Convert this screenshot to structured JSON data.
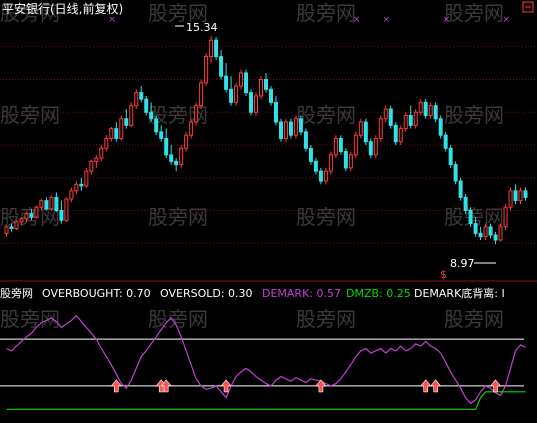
{
  "title": "平安银行(日线,前复权)",
  "watermark": "股旁网",
  "colors": {
    "background": "#000000",
    "up_candle": "#ff3b3b",
    "down_candle": "#33e0e8",
    "gridline": "#6e0f0f",
    "demark_line": "#c040d0",
    "dmzb_line": "#00dd00",
    "indicator_white": "#ffffff",
    "arrow": "#ff5050",
    "title": "#ffffff",
    "marker_x": "#c040d0"
  },
  "price_panel": {
    "high_label": "15.34",
    "low_label": "8.97"
  },
  "indicator_panel": {
    "name": "股旁网",
    "overbought_label": "OVERBOUGHT: 0.70",
    "oversold_label": "OVERSOLD: 0.30",
    "demark_label": "DEMARK: 0.57",
    "dmzb_label": "DMZB: 0.25",
    "divergence_label": "DEMARK底背离: I"
  },
  "chart_data": {
    "type": "candlestick",
    "title": "平安银行(日线,前复权)",
    "panels": [
      {
        "name": "price",
        "ylim": [
          8.0,
          16.0
        ],
        "grid": true,
        "annotations": [
          {
            "text": "15.34",
            "value": 15.34
          },
          {
            "text": "8.97",
            "value": 8.97
          }
        ],
        "candles": [
          [
            9.3,
            9.55,
            9.2,
            9.5
          ],
          [
            9.5,
            9.6,
            9.35,
            9.45
          ],
          [
            9.45,
            9.7,
            9.4,
            9.65
          ],
          [
            9.65,
            9.8,
            9.55,
            9.75
          ],
          [
            9.75,
            9.95,
            9.65,
            9.9
          ],
          [
            9.9,
            10.05,
            9.7,
            9.8
          ],
          [
            9.8,
            10.15,
            9.75,
            10.1
          ],
          [
            10.1,
            10.35,
            10.0,
            10.3
          ],
          [
            10.3,
            10.4,
            10.0,
            10.05
          ],
          [
            10.05,
            10.45,
            10.0,
            10.4
          ],
          [
            10.4,
            10.55,
            9.95,
            10.0
          ],
          [
            10.0,
            10.3,
            9.6,
            9.7
          ],
          [
            9.7,
            10.4,
            9.65,
            10.35
          ],
          [
            10.35,
            10.7,
            10.25,
            10.6
          ],
          [
            10.6,
            10.9,
            10.5,
            10.8
          ],
          [
            10.8,
            11.0,
            10.6,
            10.75
          ],
          [
            10.75,
            11.3,
            10.7,
            11.2
          ],
          [
            11.2,
            11.55,
            11.1,
            11.5
          ],
          [
            11.5,
            11.7,
            11.3,
            11.6
          ],
          [
            11.6,
            12.0,
            11.5,
            11.9
          ],
          [
            11.9,
            12.3,
            11.8,
            12.2
          ],
          [
            12.2,
            12.55,
            12.1,
            12.5
          ],
          [
            12.5,
            12.7,
            12.1,
            12.2
          ],
          [
            12.2,
            12.9,
            12.15,
            12.8
          ],
          [
            12.8,
            13.1,
            12.5,
            12.6
          ],
          [
            12.6,
            13.3,
            12.55,
            13.2
          ],
          [
            13.2,
            13.7,
            13.1,
            13.6
          ],
          [
            13.6,
            13.8,
            13.3,
            13.4
          ],
          [
            13.4,
            13.5,
            12.9,
            13.0
          ],
          [
            13.0,
            13.3,
            12.7,
            12.8
          ],
          [
            12.8,
            12.9,
            12.3,
            12.4
          ],
          [
            12.4,
            12.6,
            12.1,
            12.2
          ],
          [
            12.2,
            12.5,
            11.6,
            11.7
          ],
          [
            11.7,
            12.0,
            11.4,
            11.5
          ],
          [
            11.5,
            11.6,
            11.2,
            11.4
          ],
          [
            11.4,
            12.0,
            11.3,
            11.9
          ],
          [
            11.9,
            12.4,
            11.8,
            12.3
          ],
          [
            12.3,
            12.8,
            12.2,
            12.7
          ],
          [
            12.7,
            13.3,
            12.6,
            13.2
          ],
          [
            13.2,
            14.0,
            13.1,
            13.9
          ],
          [
            13.9,
            14.8,
            13.8,
            14.7
          ],
          [
            14.7,
            15.34,
            14.5,
            15.2
          ],
          [
            15.2,
            15.3,
            14.6,
            14.7
          ],
          [
            14.7,
            14.9,
            14.0,
            14.1
          ],
          [
            14.1,
            14.5,
            13.6,
            13.7
          ],
          [
            13.7,
            14.1,
            13.2,
            13.3
          ],
          [
            13.3,
            13.9,
            13.2,
            13.8
          ],
          [
            13.8,
            14.3,
            13.7,
            14.2
          ],
          [
            14.2,
            14.3,
            13.5,
            13.6
          ],
          [
            13.6,
            13.7,
            12.9,
            13.0
          ],
          [
            13.0,
            13.6,
            12.9,
            13.5
          ],
          [
            13.5,
            14.1,
            13.4,
            14.0
          ],
          [
            14.0,
            14.2,
            13.6,
            13.7
          ],
          [
            13.7,
            13.8,
            13.2,
            13.3
          ],
          [
            13.3,
            13.5,
            12.6,
            12.7
          ],
          [
            12.7,
            12.8,
            12.1,
            12.2
          ],
          [
            12.2,
            12.8,
            12.1,
            12.7
          ],
          [
            12.7,
            12.8,
            12.2,
            12.3
          ],
          [
            12.3,
            12.9,
            12.2,
            12.8
          ],
          [
            12.8,
            12.9,
            12.3,
            12.4
          ],
          [
            12.4,
            12.5,
            11.8,
            11.9
          ],
          [
            11.9,
            12.0,
            11.4,
            11.5
          ],
          [
            11.5,
            11.6,
            11.1,
            11.2
          ],
          [
            11.2,
            11.3,
            10.8,
            10.9
          ],
          [
            10.9,
            11.3,
            10.8,
            11.2
          ],
          [
            11.2,
            11.8,
            11.1,
            11.7
          ],
          [
            11.7,
            12.3,
            11.6,
            12.2
          ],
          [
            12.2,
            12.3,
            11.7,
            11.8
          ],
          [
            11.8,
            11.9,
            11.2,
            11.3
          ],
          [
            11.3,
            11.8,
            11.2,
            11.7
          ],
          [
            11.7,
            12.4,
            11.6,
            12.3
          ],
          [
            12.3,
            12.8,
            12.2,
            12.7
          ],
          [
            12.7,
            12.8,
            12.0,
            12.1
          ],
          [
            12.1,
            12.2,
            11.6,
            11.7
          ],
          [
            11.7,
            12.3,
            11.6,
            12.2
          ],
          [
            12.2,
            12.9,
            12.1,
            12.8
          ],
          [
            12.8,
            13.2,
            12.7,
            13.1
          ],
          [
            13.1,
            13.2,
            12.5,
            12.6
          ],
          [
            12.6,
            12.7,
            12.0,
            12.1
          ],
          [
            12.1,
            12.6,
            12.0,
            12.5
          ],
          [
            12.5,
            13.0,
            12.4,
            12.9
          ],
          [
            12.9,
            13.2,
            12.5,
            12.6
          ],
          [
            12.6,
            13.1,
            12.5,
            13.0
          ],
          [
            13.0,
            13.4,
            12.9,
            13.3
          ],
          [
            13.3,
            13.4,
            12.8,
            12.9
          ],
          [
            12.9,
            13.3,
            12.8,
            13.2
          ],
          [
            13.2,
            13.3,
            12.7,
            12.8
          ],
          [
            12.8,
            12.9,
            12.2,
            12.3
          ],
          [
            12.3,
            12.4,
            11.8,
            11.9
          ],
          [
            11.9,
            12.0,
            11.3,
            11.4
          ],
          [
            11.4,
            11.5,
            10.8,
            10.9
          ],
          [
            10.9,
            11.0,
            10.3,
            10.4
          ],
          [
            10.4,
            10.5,
            9.9,
            10.0
          ],
          [
            10.0,
            10.1,
            9.5,
            9.6
          ],
          [
            9.6,
            9.8,
            9.2,
            9.3
          ],
          [
            9.3,
            9.5,
            9.1,
            9.2
          ],
          [
            9.2,
            9.6,
            9.1,
            9.5
          ],
          [
            9.5,
            9.6,
            9.15,
            9.25
          ],
          [
            9.25,
            9.35,
            8.97,
            9.1
          ],
          [
            9.1,
            9.6,
            9.05,
            9.5
          ],
          [
            9.5,
            10.2,
            9.4,
            10.1
          ],
          [
            10.1,
            10.7,
            10.0,
            10.6
          ],
          [
            10.6,
            10.8,
            10.2,
            10.3
          ],
          [
            10.3,
            10.7,
            10.2,
            10.6
          ],
          [
            10.6,
            10.7,
            10.3,
            10.4
          ]
        ]
      },
      {
        "name": "indicator",
        "ylim": [
          0.0,
          1.0
        ],
        "levels": [
          {
            "name": "OVERBOUGHT",
            "value": 0.7
          },
          {
            "name": "OVERSOLD",
            "value": 0.3
          }
        ],
        "series": [
          {
            "name": "DEMARK",
            "values": [
              0.62,
              0.6,
              0.64,
              0.68,
              0.72,
              0.75,
              0.8,
              0.84,
              0.86,
              0.88,
              0.85,
              0.8,
              0.83,
              0.86,
              0.9,
              0.85,
              0.8,
              0.75,
              0.7,
              0.62,
              0.55,
              0.48,
              0.4,
              0.32,
              0.28,
              0.35,
              0.45,
              0.55,
              0.6,
              0.66,
              0.72,
              0.78,
              0.84,
              0.88,
              0.82,
              0.72,
              0.6,
              0.48,
              0.36,
              0.3,
              0.27,
              0.28,
              0.3,
              0.25,
              0.2,
              0.3,
              0.38,
              0.42,
              0.45,
              0.42,
              0.38,
              0.35,
              0.32,
              0.3,
              0.35,
              0.38,
              0.36,
              0.34,
              0.37,
              0.35,
              0.33,
              0.36,
              0.35,
              0.34,
              0.32,
              0.3,
              0.32,
              0.36,
              0.42,
              0.48,
              0.55,
              0.6,
              0.62,
              0.58,
              0.6,
              0.62,
              0.58,
              0.62,
              0.6,
              0.64,
              0.6,
              0.62,
              0.66,
              0.64,
              0.68,
              0.64,
              0.62,
              0.58,
              0.5,
              0.42,
              0.35,
              0.28,
              0.2,
              0.15,
              0.18,
              0.25,
              0.3,
              0.28,
              0.24,
              0.22,
              0.3,
              0.45,
              0.6,
              0.65,
              0.63
            ]
          },
          {
            "name": "DMZB",
            "values": [
              0.1,
              0.1,
              0.1,
              0.1,
              0.1,
              0.1,
              0.1,
              0.1,
              0.1,
              0.1,
              0.1,
              0.1,
              0.1,
              0.1,
              0.1,
              0.1,
              0.1,
              0.1,
              0.1,
              0.1,
              0.1,
              0.1,
              0.1,
              0.1,
              0.1,
              0.1,
              0.1,
              0.1,
              0.1,
              0.1,
              0.1,
              0.1,
              0.1,
              0.1,
              0.1,
              0.1,
              0.1,
              0.1,
              0.1,
              0.1,
              0.1,
              0.1,
              0.1,
              0.1,
              0.1,
              0.1,
              0.1,
              0.1,
              0.1,
              0.1,
              0.1,
              0.1,
              0.1,
              0.1,
              0.1,
              0.1,
              0.1,
              0.1,
              0.1,
              0.1,
              0.1,
              0.1,
              0.1,
              0.1,
              0.1,
              0.1,
              0.1,
              0.1,
              0.1,
              0.1,
              0.1,
              0.1,
              0.1,
              0.1,
              0.1,
              0.1,
              0.1,
              0.1,
              0.1,
              0.1,
              0.1,
              0.1,
              0.1,
              0.1,
              0.1,
              0.1,
              0.1,
              0.1,
              0.1,
              0.1,
              0.1,
              0.1,
              0.1,
              0.1,
              0.1,
              0.2,
              0.25,
              0.25,
              0.25,
              0.25,
              0.25,
              0.25,
              0.25,
              0.25,
              0.25
            ]
          }
        ],
        "signals": [
          22,
          31,
          32,
          44,
          63,
          84,
          86,
          98
        ]
      }
    ],
    "markers_x": [
      21,
      70,
      76,
      88,
      100
    ]
  }
}
